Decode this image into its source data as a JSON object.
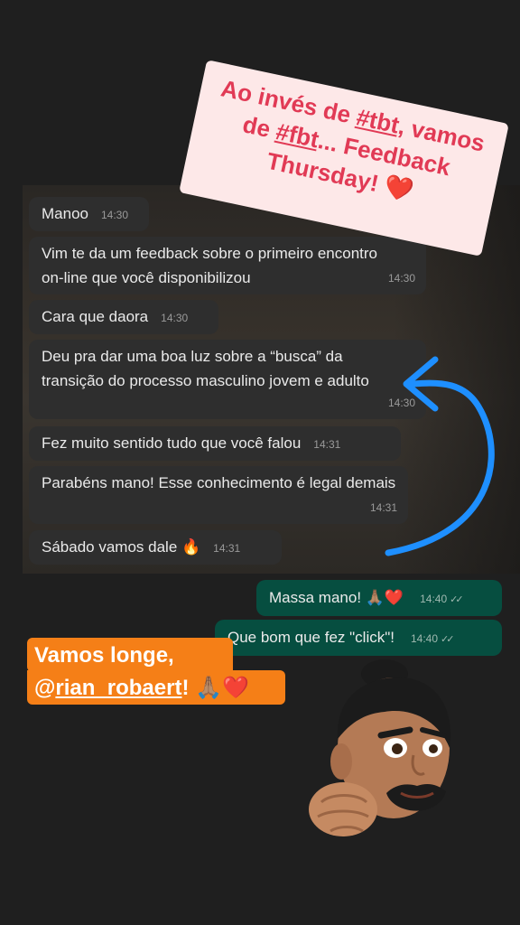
{
  "story": {
    "headline": {
      "line1_prefix": "Ao invés de ",
      "hashtag1": "#tbt",
      "line1_suffix": ", vamos",
      "line2_prefix": "de ",
      "hashtag2": "#fbt",
      "line2_suffix": "... Feedback",
      "line3": "Thursday!",
      "emoji": "❤️"
    },
    "caption": {
      "line1": "Vamos longe,",
      "mention_at": "@",
      "mention": "rian_robaert",
      "line2_suffix": "!",
      "emoji": "🙏🏽❤️"
    },
    "memoji_icon": "memoji-fist-bump"
  },
  "chat": {
    "incoming": [
      {
        "text": "Manoo",
        "time": "14:30"
      },
      {
        "text": "Vim te da um feedback sobre o primeiro encontro on-line que você disponibilizou",
        "time": "14:30"
      },
      {
        "text": "Cara que daora",
        "time": "14:30"
      },
      {
        "text": "Deu pra dar uma boa luz sobre a “busca” da transição do processo masculino jovem e adulto",
        "time": "14:30"
      },
      {
        "text": "Fez muito sentido tudo que você falou",
        "time": "14:31"
      },
      {
        "text": "Parabéns mano! Esse conhecimento é legal demais",
        "time": "14:31"
      },
      {
        "text": "Sábado vamos dale 🔥",
        "time": "14:31"
      }
    ],
    "outgoing": [
      {
        "text": "Massa mano! 🙏🏽❤️",
        "time": "14:40",
        "ticks": "✓✓"
      },
      {
        "text": "Que bom que fez \"click\"!",
        "time": "14:40",
        "ticks": "✓✓"
      }
    ]
  },
  "colors": {
    "headline_bg": "#fde8e8",
    "headline_text": "#e13a55",
    "caption_bg": "#f57f17",
    "incoming_bubble": "#2e2e2e",
    "outgoing_bubble": "#064e40",
    "arrow": "#1e8fff"
  }
}
